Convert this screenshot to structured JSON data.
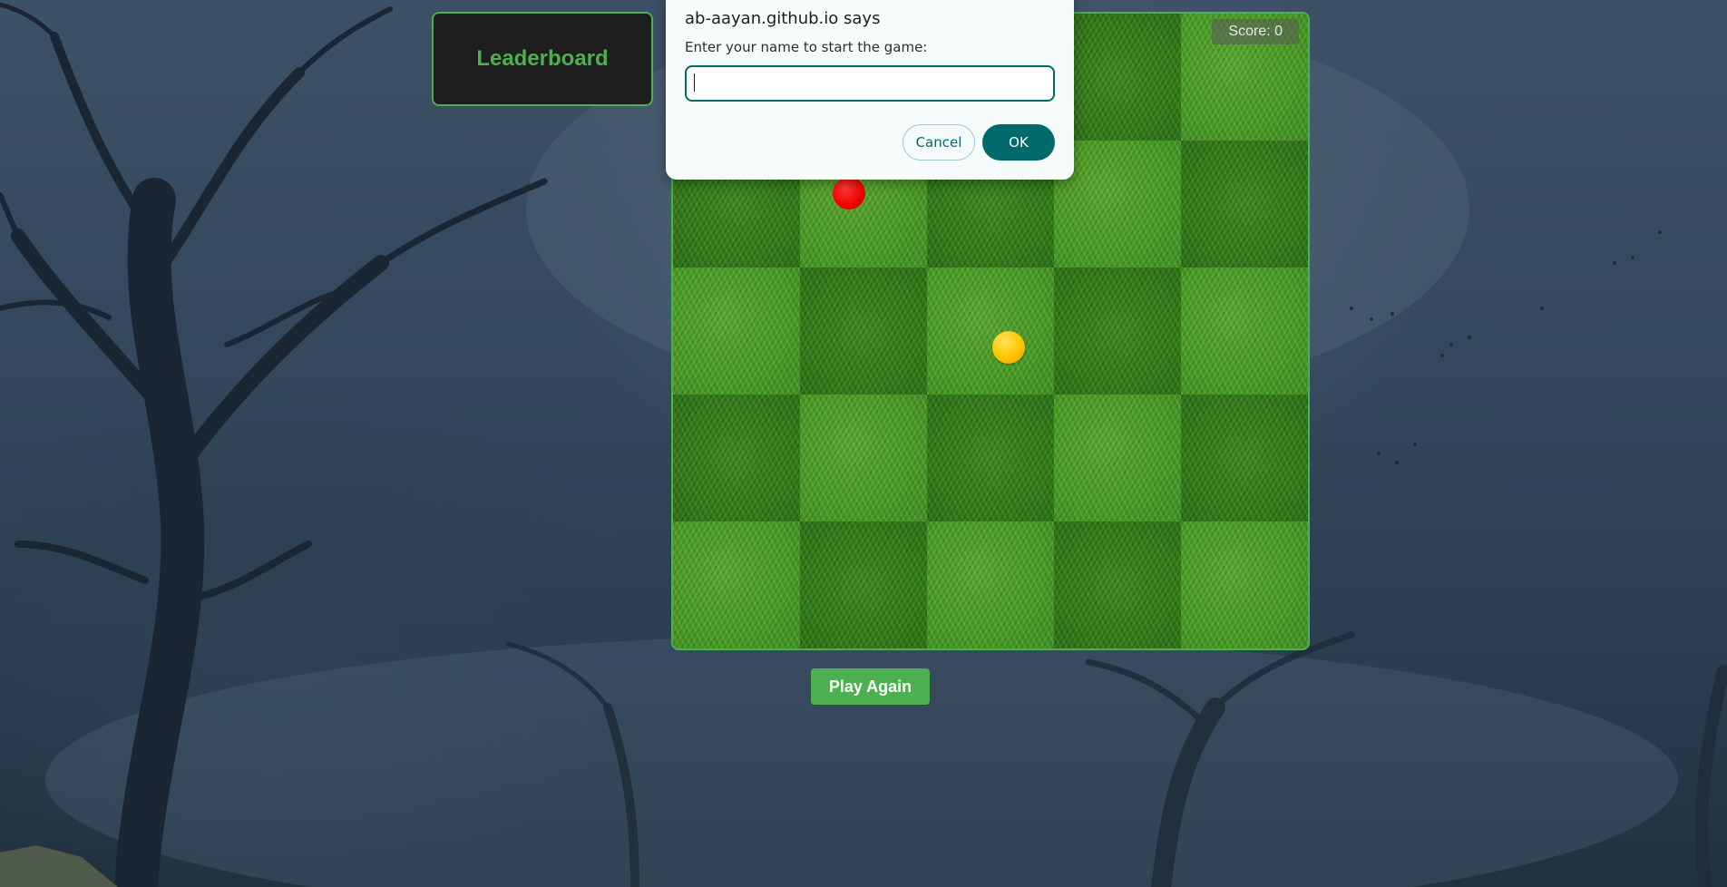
{
  "leaderboard": {
    "title": "Leaderboard"
  },
  "game": {
    "score_label": "Score: 0",
    "play_again_label": "Play Again",
    "snake_food_color": "#f00000",
    "ball_color": "#ffc400",
    "accent_color": "#4caf50"
  },
  "dialog": {
    "title": "ab-aayan.github.io says",
    "message": "Enter your name to start the game:",
    "input_value": "",
    "cancel_label": "Cancel",
    "ok_label": "OK",
    "accent_color": "#006a6a"
  }
}
